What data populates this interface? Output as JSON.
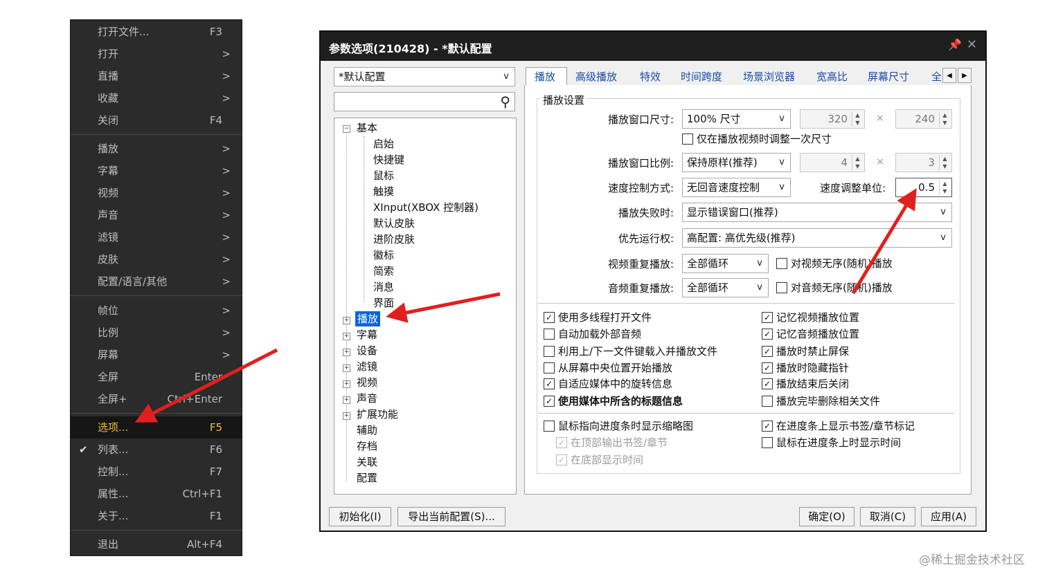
{
  "context_menu": {
    "items": [
      {
        "label": "打开文件...",
        "accel": "F3",
        "submenu": ""
      },
      {
        "label": "打开",
        "accel": "",
        "submenu": ">"
      },
      {
        "label": "直播",
        "accel": "",
        "submenu": ">"
      },
      {
        "label": "收藏",
        "accel": "",
        "submenu": ">"
      },
      {
        "label": "关闭",
        "accel": "F4",
        "submenu": ""
      },
      {
        "label": "播放",
        "accel": "",
        "submenu": ">"
      },
      {
        "label": "字幕",
        "accel": "",
        "submenu": ">"
      },
      {
        "label": "视频",
        "accel": "",
        "submenu": ">"
      },
      {
        "label": "声音",
        "accel": "",
        "submenu": ">"
      },
      {
        "label": "滤镜",
        "accel": "",
        "submenu": ">"
      },
      {
        "label": "皮肤",
        "accel": "",
        "submenu": ">"
      },
      {
        "label": "配置/语言/其他",
        "accel": "",
        "submenu": ">"
      },
      {
        "label": "帧位",
        "accel": "",
        "submenu": ">"
      },
      {
        "label": "比例",
        "accel": "",
        "submenu": ">"
      },
      {
        "label": "屏幕",
        "accel": "",
        "submenu": ">"
      },
      {
        "label": "全屏",
        "accel": "Enter",
        "submenu": ""
      },
      {
        "label": "全屏+",
        "accel": "Ctrl+Enter",
        "submenu": ""
      },
      {
        "label": "选项...",
        "accel": "F5",
        "submenu": ""
      },
      {
        "label": "列表...",
        "accel": "F6",
        "submenu": "",
        "check": "✔"
      },
      {
        "label": "控制...",
        "accel": "F7",
        "submenu": ""
      },
      {
        "label": "属性...",
        "accel": "Ctrl+F1",
        "submenu": ""
      },
      {
        "label": "关于...",
        "accel": "F1",
        "submenu": ""
      },
      {
        "label": "退出",
        "accel": "Alt+F4",
        "submenu": ""
      }
    ]
  },
  "dialog": {
    "title": "参数选项(210428) - *默认配置",
    "pin_icon": "📌",
    "close_icon": "✕",
    "profile_combo": "*默认配置",
    "search_icon": "⚲",
    "tree": {
      "root": "基本",
      "children": [
        "启始",
        "快捷键",
        "鼠标",
        "触摸",
        "XInput(XBOX 控制器)",
        "默认皮肤",
        "进阶皮肤",
        "徽标",
        "简索",
        "消息",
        "界面"
      ],
      "top_nodes": [
        "播放",
        "字幕",
        "设备",
        "滤镜",
        "视频",
        "声音",
        "扩展功能",
        "辅助",
        "存档",
        "关联",
        "配置"
      ]
    },
    "tabs": [
      "播放",
      "高级播放",
      "特效",
      "时间跨度",
      "场景浏览器",
      "宽高比",
      "屏幕尺寸",
      "全"
    ],
    "group_title": "播放设置",
    "labels": {
      "window_size": "播放窗口尺寸:",
      "window_ratio": "播放窗口比例:",
      "speed_mode": "速度控制方式:",
      "speed_unit": "速度调整单位:",
      "fail": "播放失败时:",
      "priority": "优先运行权:",
      "video_repeat": "视频重复播放:",
      "audio_repeat": "音频重复播放:"
    },
    "values": {
      "window_size": "100% 尺寸",
      "width": "320",
      "height": "240",
      "window_ratio": "保持原样(推荐)",
      "ratio_w": "4",
      "ratio_h": "3",
      "speed_mode": "无回音速度控制",
      "speed_unit": "0.5",
      "fail": "显示错误窗口(推荐)",
      "priority": "高配置: 高优先级(推荐)",
      "video_repeat": "全部循环",
      "audio_repeat": "全部循环",
      "times": "×"
    },
    "resize_once": "仅在播放视频时调整一次尺寸",
    "video_shuffle": "对视频无序(随机)播放",
    "audio_shuffle": "对音频无序(随机)播放",
    "checks_left": [
      {
        "label": "使用多线程打开文件",
        "mark": "✓"
      },
      {
        "label": "自动加载外部音频",
        "mark": ""
      },
      {
        "label": "利用上/下一文件键载入并播放文件",
        "mark": ""
      },
      {
        "label": "从屏幕中央位置开始播放",
        "mark": ""
      },
      {
        "label": "自适应媒体中的旋转信息",
        "mark": "✓"
      },
      {
        "label": "使用媒体中所含的标题信息",
        "mark": "✓"
      }
    ],
    "checks_right": [
      {
        "label": "记忆视频播放位置",
        "mark": "✓"
      },
      {
        "label": "记忆音频播放位置",
        "mark": "✓"
      },
      {
        "label": "播放时禁止屏保",
        "mark": "✓"
      },
      {
        "label": "播放时隐藏指针",
        "mark": "✓"
      },
      {
        "label": "播放结束后关闭",
        "mark": "✓"
      },
      {
        "label": "播放完毕删除相关文件",
        "mark": ""
      }
    ],
    "thumb_check": {
      "label": "鼠标指向进度条时显示缩略图",
      "mark": ""
    },
    "thumb_sub": [
      {
        "label": "在顶部输出书签/章节",
        "mark": "✓"
      },
      {
        "label": "在底部显示时间",
        "mark": "✓"
      }
    ],
    "progress_checks": [
      {
        "label": "在进度条上显示书签/章节标记",
        "mark": "✓"
      },
      {
        "label": "鼠标在进度条上时显示时间",
        "mark": ""
      }
    ],
    "buttons": {
      "init": "初始化(I)",
      "export": "导出当前配置(S)...",
      "ok": "确定(O)",
      "cancel": "取消(C)",
      "apply": "应用(A)"
    }
  },
  "watermark": "@稀土掘金技术社区",
  "colors": {
    "arrow": "#e0201e",
    "menu_bg": "#2b2b2b",
    "highlight": "#f0c030",
    "tree_sel": "#0a64d8"
  }
}
